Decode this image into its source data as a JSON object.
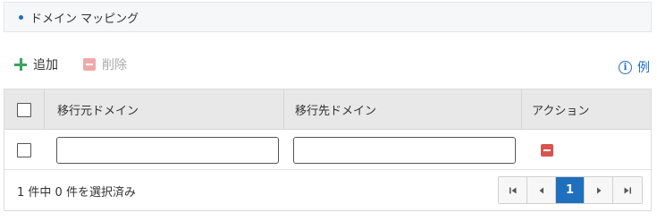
{
  "section": {
    "title": "ドメイン マッピング"
  },
  "toolbar": {
    "add_label": "追加",
    "delete_label": "削除",
    "example_label": "例",
    "info_glyph": "i"
  },
  "table": {
    "columns": [
      "移行元ドメイン",
      "移行先ドメイン",
      "アクション"
    ],
    "rows": [
      {
        "source_domain": "",
        "target_domain": ""
      }
    ]
  },
  "footer": {
    "selection_text": "1 件中 0 件を選択済み"
  },
  "pagination": {
    "current_page": "1"
  },
  "colors": {
    "accent": "#1f6fbf",
    "add_green": "#3aa361",
    "delete_red": "#d9534f",
    "delete_disabled": "#f0a9a9",
    "header_bg": "#e8e8e8"
  },
  "icons": {
    "add": "plus-icon",
    "delete": "minus-box-icon",
    "info": "info-circle-icon",
    "first": "first-page-icon",
    "prev": "prev-page-icon",
    "next": "next-page-icon",
    "last": "last-page-icon"
  }
}
